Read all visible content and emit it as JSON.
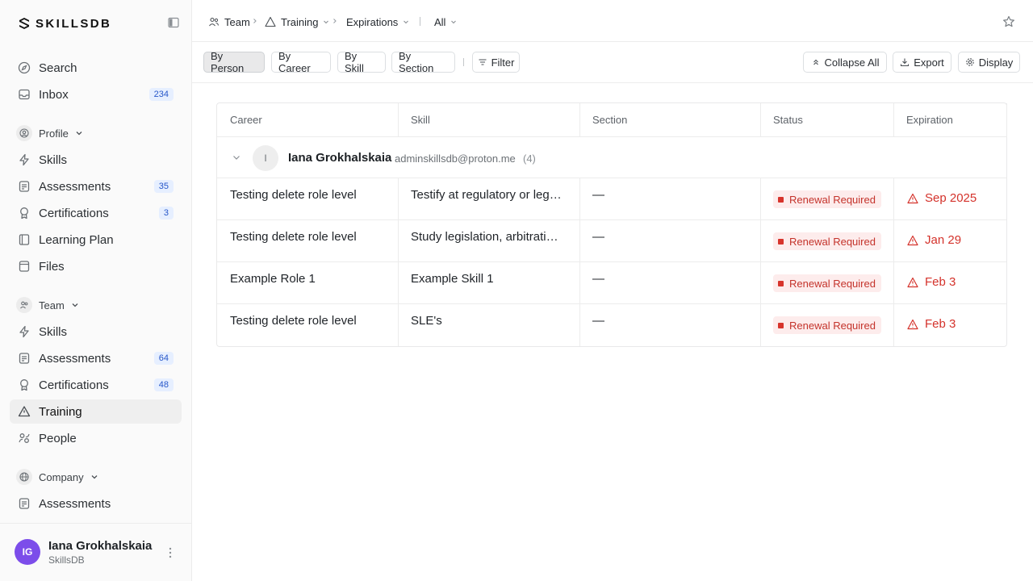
{
  "brand": {
    "name": "SKILLSDB"
  },
  "sidebar": {
    "top": [
      {
        "label": "Search",
        "icon": "compass-icon"
      },
      {
        "label": "Inbox",
        "icon": "inbox-icon",
        "badge": "234"
      }
    ],
    "profile_section": {
      "label": "Profile",
      "items": [
        {
          "label": "Skills",
          "icon": "bolt-icon"
        },
        {
          "label": "Assessments",
          "icon": "assessment-icon",
          "badge": "35"
        },
        {
          "label": "Certifications",
          "icon": "ribbon-icon",
          "badge": "3"
        },
        {
          "label": "Learning Plan",
          "icon": "book-icon"
        },
        {
          "label": "Files",
          "icon": "file-icon"
        }
      ]
    },
    "team_section": {
      "label": "Team",
      "items": [
        {
          "label": "Skills",
          "icon": "bolt-icon"
        },
        {
          "label": "Assessments",
          "icon": "assessment-icon",
          "badge": "64"
        },
        {
          "label": "Certifications",
          "icon": "ribbon-icon",
          "badge": "48"
        },
        {
          "label": "Training",
          "icon": "warning-triangle-icon",
          "active": true
        },
        {
          "label": "People",
          "icon": "people-icon"
        }
      ]
    },
    "company_section": {
      "label": "Company",
      "items": [
        {
          "label": "Assessments",
          "icon": "assessment-icon"
        }
      ]
    },
    "user": {
      "initials": "IG",
      "name": "Iana Grokhalskaia",
      "org": "SkillsDB"
    }
  },
  "topbar": {
    "breadcrumbs": [
      {
        "label": "Team"
      },
      {
        "label": "Training"
      },
      {
        "label": "Expirations"
      },
      {
        "label": "All"
      }
    ]
  },
  "toolbar": {
    "group_by": [
      "By Person",
      "By Career",
      "By Skill",
      "By Section"
    ],
    "active_group": "By Person",
    "filter_label": "Filter",
    "collapse_label": "Collapse All",
    "export_label": "Export",
    "display_label": "Display"
  },
  "table": {
    "columns": [
      "Career",
      "Skill",
      "Section",
      "Status",
      "Expiration"
    ],
    "group": {
      "avatar_letter": "I",
      "name": "Iana Grokhalskaia",
      "email": "adminskillsdb@proton.me",
      "count": "(4)"
    },
    "rows": [
      {
        "career": "Testing delete role level",
        "skill": "Testify at regulatory or legislative hearings",
        "section": "—",
        "status": "Renewal Required",
        "expiration": "Sep 2025"
      },
      {
        "career": "Testing delete role level",
        "skill": "Study legislation, arbitration decisions",
        "section": "—",
        "status": "Renewal Required",
        "expiration": "Jan 29"
      },
      {
        "career": "Example Role 1",
        "skill": "Example Skill 1",
        "section": "—",
        "status": "Renewal Required",
        "expiration": "Feb 3"
      },
      {
        "career": "Testing delete role level",
        "skill": "SLE's",
        "section": "—",
        "status": "Renewal Required",
        "expiration": "Feb 3"
      }
    ]
  },
  "colors": {
    "accent": "#7c4dea",
    "badge_bg": "#e6efff",
    "badge_text": "#2757c9",
    "status_red": "#d4322b",
    "status_bg": "#fdecec"
  }
}
